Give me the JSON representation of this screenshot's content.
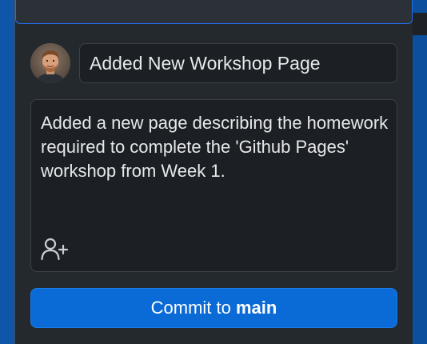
{
  "commit": {
    "summary_value": "Added New Workshop Page",
    "description_value": "Added a new page describing the homework required to complete the 'Github Pages' workshop from Week 1.",
    "button_prefix": "Commit to ",
    "branch_name": "main"
  },
  "icons": {
    "avatar": "user-avatar",
    "coauthor": "add-coauthor-icon"
  },
  "colors": {
    "panel_bg": "#24292e",
    "input_bg": "#1c2025",
    "button_bg": "#0b6bd6",
    "accent_border": "#1f6feb"
  }
}
